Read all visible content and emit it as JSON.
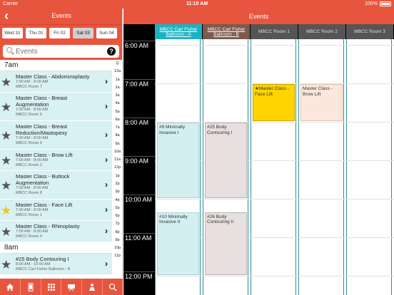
{
  "status_bar": {
    "carrier": "Carrier",
    "time": "11:10 AM",
    "battery": "100%"
  },
  "left_panel": {
    "title": "Events",
    "days": [
      {
        "label": "Wed 31",
        "selected": false
      },
      {
        "label": "Thu 01",
        "selected": false
      },
      {
        "label": "Fri 02",
        "selected": false
      },
      {
        "label": "Sat 03",
        "selected": true
      },
      {
        "label": "Sun 04",
        "selected": false
      }
    ],
    "search_placeholder": "Events",
    "sections": [
      {
        "header": "7am",
        "items": [
          {
            "name": "Master Class - Abdominoplasty",
            "time": "7:00 AM - 8:00 AM",
            "room": "MBCC Room 7",
            "starred": false
          },
          {
            "name": "Master Class - Breast Augmentation",
            "time": "7:00 AM - 8:00 AM",
            "room": "MBCC Room 5",
            "starred": false
          },
          {
            "name": "Master Class - Breast Reduction/Mastopexy",
            "time": "7:00 AM - 8:00 AM",
            "room": "MBCC Room 6",
            "starred": false
          },
          {
            "name": "Master Class - Brow Lift",
            "time": "7:00 AM - 8:00 AM",
            "room": "MBCC Room 2",
            "starred": false
          },
          {
            "name": "Master Class - Buttock Augmentation",
            "time": "7:00 AM - 8:00 AM",
            "room": "MBCC Room 8",
            "starred": false
          },
          {
            "name": "Master Class - Face Lift",
            "time": "7:00 AM - 8:00 AM",
            "room": "MBCC Room 1",
            "starred": true
          },
          {
            "name": "Master Class - Rhinoplasty",
            "time": "7:00 AM - 8:00 AM",
            "room": "MBCC Room 4",
            "starred": false
          }
        ]
      },
      {
        "header": "8am",
        "items": [
          {
            "name": "#25 Body Contouring I",
            "time": "8:00 AM - 10:00 AM",
            "room": "MBCC Carl Fisher Ballroom - B",
            "starred": false
          }
        ]
      }
    ],
    "index": [
      "Q",
      "12a",
      "1a",
      "2a",
      "3a",
      "4a",
      "5a",
      "6a",
      "7a",
      "8a",
      "9a",
      "10a",
      "11a",
      "12p",
      "1p",
      "2p",
      "3p",
      "4p",
      "5p",
      "6p",
      "7p",
      "8p",
      "9p",
      "10p",
      "11p"
    ]
  },
  "calendar": {
    "title": "Events",
    "rooms": [
      {
        "label": "MBCC Carl Fisher Ballroom - A",
        "style": "teal"
      },
      {
        "label": "MBCC Carl Fisher Ballroom - B",
        "style": "brown"
      },
      {
        "label": "MBCC Room 1",
        "style": "dark"
      },
      {
        "label": "MBCC Room 2",
        "style": "dark"
      },
      {
        "label": "MBCC Room 3",
        "style": "dark"
      }
    ],
    "hours": [
      "6:00 AM",
      "7:00 AM",
      "8:00 AM",
      "9:00 AM",
      "10:00 AM",
      "11:00 AM",
      "12:00 PM"
    ],
    "events": [
      {
        "title": "Master Class - Face Lift",
        "starred": true,
        "room": 2,
        "start": 7.0,
        "end": 8.0,
        "style": "yellow"
      },
      {
        "title": "Master Class - Brow Lift",
        "starred": false,
        "room": 3,
        "start": 7.0,
        "end": 8.0,
        "style": "peach"
      },
      {
        "title": "#9 Minimally Invasive I",
        "starred": false,
        "room": 0,
        "start": 8.0,
        "end": 10.0,
        "style": "teal"
      },
      {
        "title": "#25 Body Contouring I",
        "starred": false,
        "room": 1,
        "start": 8.0,
        "end": 10.0,
        "style": "grey"
      },
      {
        "title": "#10 Minimally Invasive II",
        "starred": false,
        "room": 0,
        "start": 10.33,
        "end": 12.0,
        "style": "teal"
      },
      {
        "title": "#26 Body Contouring II",
        "starred": false,
        "room": 1,
        "start": 10.33,
        "end": 12.0,
        "style": "grey"
      }
    ]
  },
  "tab_icons": [
    "home-icon",
    "phone-icon",
    "grid-icon",
    "presentation-icon",
    "person-icon",
    "search-icon"
  ]
}
